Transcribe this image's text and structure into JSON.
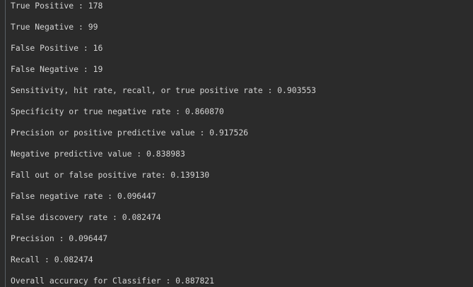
{
  "console": {
    "lines": [
      "True Positive : 178",
      "True Negative : 99",
      "False Positive : 16",
      "False Negative : 19",
      "Sensitivity, hit rate, recall, or true positive rate : 0.903553",
      "Specificity or true negative rate : 0.860870",
      "Precision or positive predictive value : 0.917526",
      "Negative predictive value : 0.838983",
      "Fall out or false positive rate: 0.139130",
      "False negative rate : 0.096447",
      "False discovery rate : 0.082474",
      "Precision : 0.096447",
      "Recall : 0.082474",
      "Overall accuracy for Classifier : 0.887821"
    ]
  },
  "colors": {
    "background": "#2b2b2b",
    "text": "#d4d4d4",
    "gutter": "#5a5f66"
  }
}
